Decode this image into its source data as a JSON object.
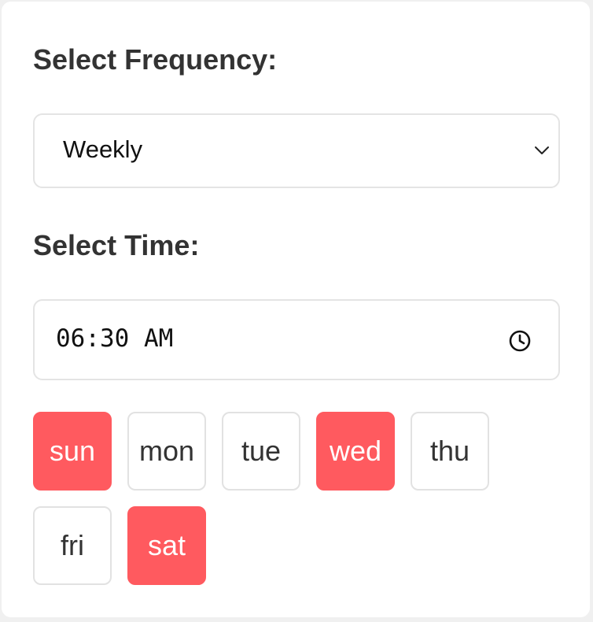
{
  "frequency": {
    "label": "Select Frequency:",
    "selected": "Weekly"
  },
  "time": {
    "label": "Select Time:",
    "value": "06:30 AM"
  },
  "colors": {
    "selected_day": "#ff5a5f",
    "unselected_day": "#ffffff",
    "label_text": "#333333"
  },
  "days": [
    {
      "label": "sun",
      "selected": true
    },
    {
      "label": "mon",
      "selected": false
    },
    {
      "label": "tue",
      "selected": false
    },
    {
      "label": "wed",
      "selected": true
    },
    {
      "label": "thu",
      "selected": false
    },
    {
      "label": "fri",
      "selected": false
    },
    {
      "label": "sat",
      "selected": true
    }
  ],
  "icons": {
    "select": "chevron-down-icon",
    "time": "clock-icon"
  }
}
